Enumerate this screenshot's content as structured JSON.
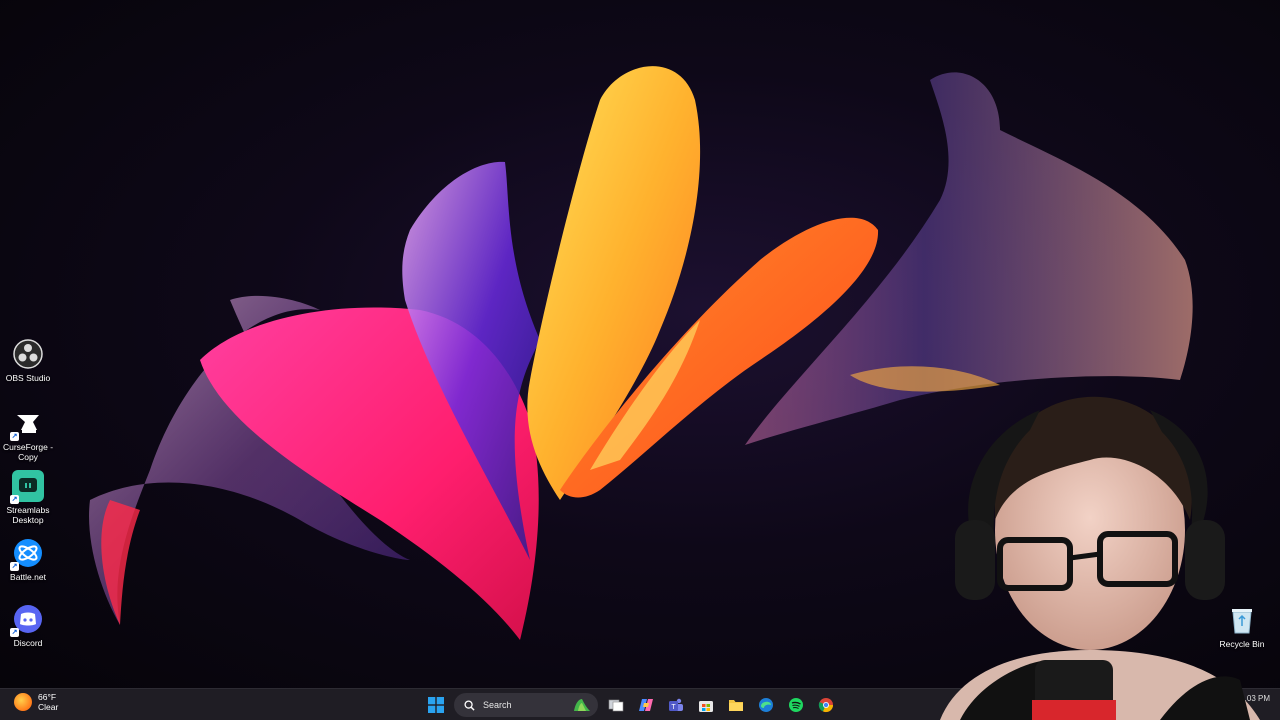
{
  "desktop_icons": [
    {
      "label": "OBS Studio",
      "icon": "obs-icon"
    },
    {
      "label": "CurseForge - Copy",
      "icon": "curseforge-icon"
    },
    {
      "label": "Streamlabs Desktop",
      "icon": "streamlabs-icon"
    },
    {
      "label": "Battle.net",
      "icon": "battlenet-icon"
    },
    {
      "label": "Discord",
      "icon": "discord-icon"
    }
  ],
  "recycle_bin": {
    "label": "Recycle Bin",
    "icon": "recycle-bin-icon"
  },
  "taskbar": {
    "weather": {
      "temp": "66°F",
      "condition": "Clear",
      "icon": "sun-icon"
    },
    "search_placeholder": "Search",
    "apps": [
      "start-icon",
      "file-explorer-icon",
      "task-view-icon",
      "copilot-icon",
      "teams-icon",
      "store-icon",
      "folder-icon",
      "edge-icon",
      "spotify-icon",
      "chrome-icon"
    ],
    "clock": "…03 PM"
  },
  "colors": {
    "taskbar_bg": "#1f1d24",
    "desktop_bg": "#0e0818",
    "accent": "#0b5cd6"
  }
}
